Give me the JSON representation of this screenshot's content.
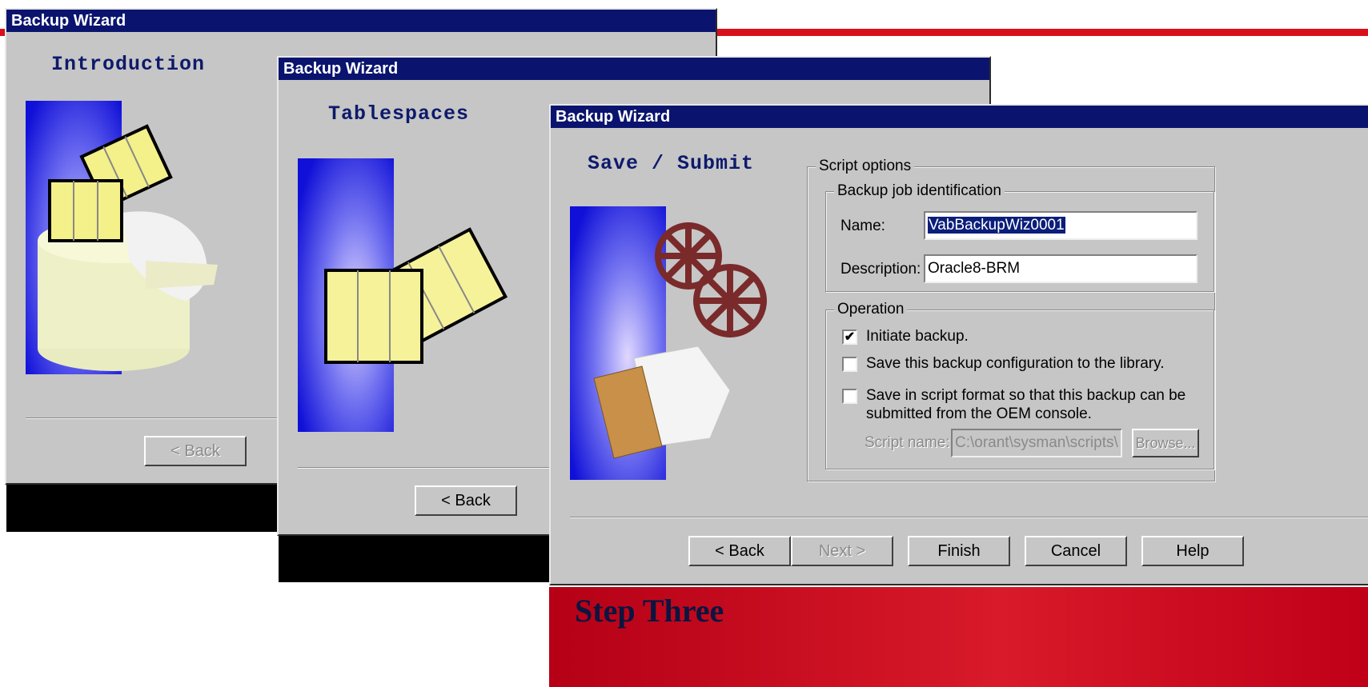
{
  "window1": {
    "title": "Backup Wizard",
    "heading": "Introduction",
    "back_label": "< Back"
  },
  "window2": {
    "title": "Backup Wizard",
    "heading": "Tablespaces",
    "back_label": "< Back"
  },
  "window3": {
    "title": "Backup Wizard",
    "heading": "Save / Submit",
    "script_options": {
      "legend": "Script options",
      "job_identification": {
        "legend": "Backup job identification",
        "name_label": "Name:",
        "name_value": "VabBackupWiz0001",
        "description_label": "Description:",
        "description_value": "Oracle8-BRM"
      },
      "operation": {
        "legend": "Operation",
        "initiate_label": "Initiate backup.",
        "initiate_checked": true,
        "save_library_label": "Save this backup configuration to the library.",
        "save_library_checked": false,
        "save_script_label_line1": "Save in script format so that this backup can be",
        "save_script_label_line2": "submitted from the OEM console.",
        "save_script_checked": false,
        "script_name_label": "Script name:",
        "script_name_value": "C:\\orant\\sysman\\scripts\\",
        "browse_label": "Browse..."
      }
    },
    "buttons": {
      "back": "< Back",
      "next": "Next >",
      "finish": "Finish",
      "cancel": "Cancel",
      "help": "Help"
    }
  },
  "caption": "Step Three",
  "colors": {
    "titlebar": "#0a146e",
    "accent_red": "#d8101c",
    "dialog_gray": "#c6c6c6",
    "heading_blue": "#0d1a6b"
  }
}
